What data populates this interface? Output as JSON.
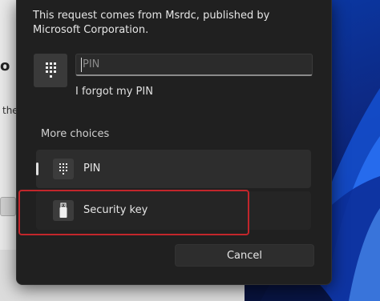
{
  "dialog": {
    "request_text": "This request comes from Msrdc, published by Microsoft Corporation.",
    "pin_placeholder": "PIN",
    "forgot_pin": "I forgot my PIN",
    "more_choices": "More choices",
    "options": [
      {
        "label": "PIN",
        "icon": "keypad-icon",
        "selected": true
      },
      {
        "label": "Security key",
        "icon": "usb-key-icon",
        "selected": false
      }
    ],
    "cancel": "Cancel"
  },
  "background": {
    "left_window_text_1": "o",
    "left_window_text_2": "the"
  },
  "colors": {
    "dialog_bg": "#202020",
    "highlight_border": "#c2262b",
    "wallpaper": "#0a3aa8"
  }
}
